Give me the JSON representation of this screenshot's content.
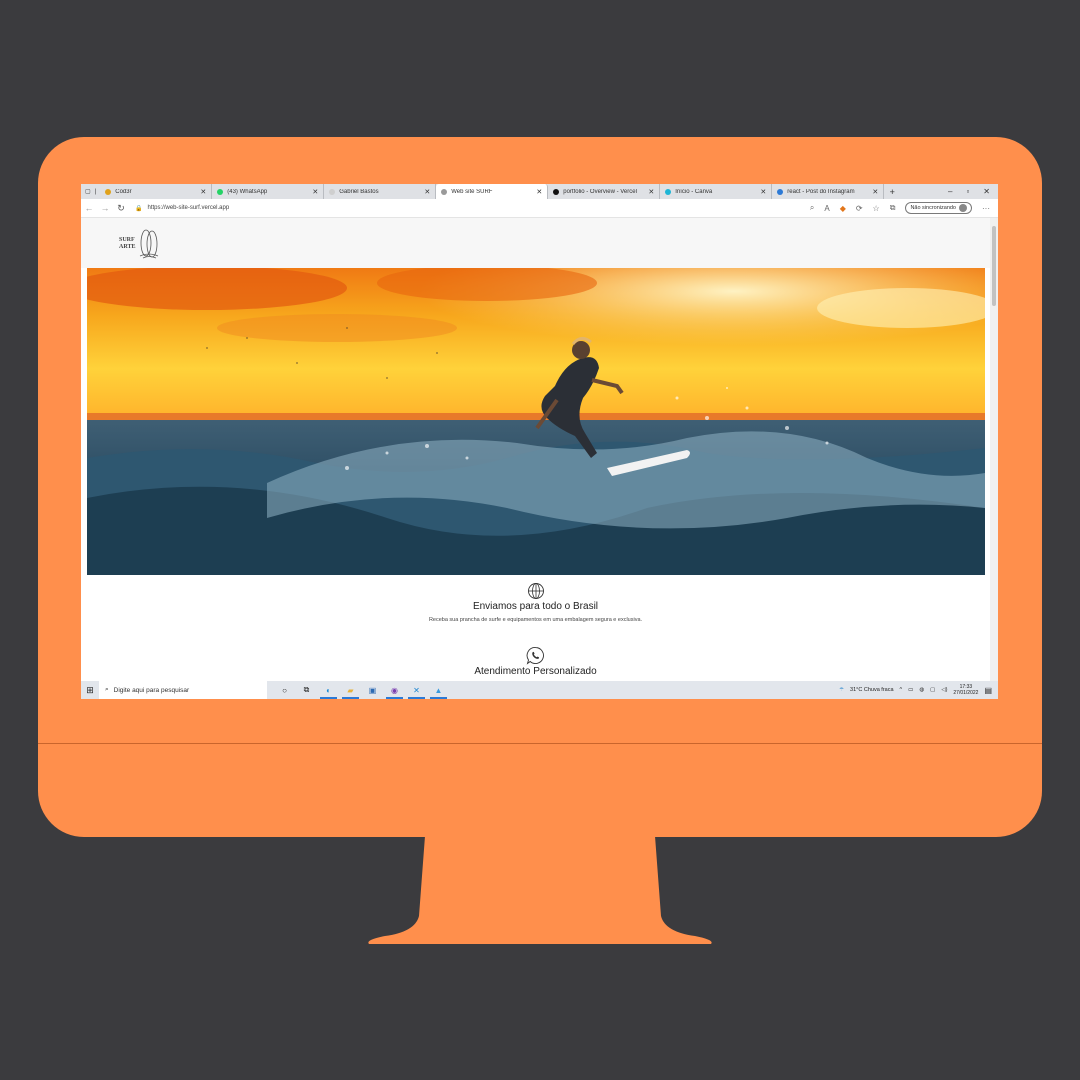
{
  "browser": {
    "tabs": [
      {
        "label": "Cod3r",
        "favicon_color": "#e0a21c",
        "active": false
      },
      {
        "label": "(43) WhatsApp",
        "favicon_color": "#25d366",
        "active": false
      },
      {
        "label": "Gabriel Bastos",
        "favicon_color": "#cfcfcf",
        "active": false
      },
      {
        "label": "Web site SURF",
        "favicon_color": "#9a9a9a",
        "active": true
      },
      {
        "label": "portfolio - Overview - Vercel",
        "favicon_color": "#111111",
        "active": false
      },
      {
        "label": "Início - Canva",
        "favicon_color": "#1fb6d6",
        "active": false
      },
      {
        "label": "react - Post do Instagram",
        "favicon_color": "#2d7ad6",
        "active": false
      }
    ],
    "url": "https://web-site-surf.vercel.app",
    "profile_label": "Não sincronizando"
  },
  "site": {
    "logo_line1": "SURF",
    "logo_line2": "ARTE",
    "features": [
      {
        "title": "Enviamos para todo o Brasil",
        "description": "Receba sua prancha de surfe e equipamentos em uma embalagem segura e exclusiva.",
        "icon": "globe-icon"
      },
      {
        "title": "Atendimento Personalizado",
        "description": "",
        "icon": "whatsapp-icon"
      }
    ]
  },
  "taskbar": {
    "search_placeholder": "Digite aqui para pesquisar",
    "weather": "31°C  Chuva fraca",
    "time": "17:33",
    "date": "27/01/2022"
  },
  "colors": {
    "background": "#3b3b3e",
    "monitor": "#ff8f4c",
    "tabbar": "#dfe1e5",
    "taskbar": "#e2e6ec"
  }
}
